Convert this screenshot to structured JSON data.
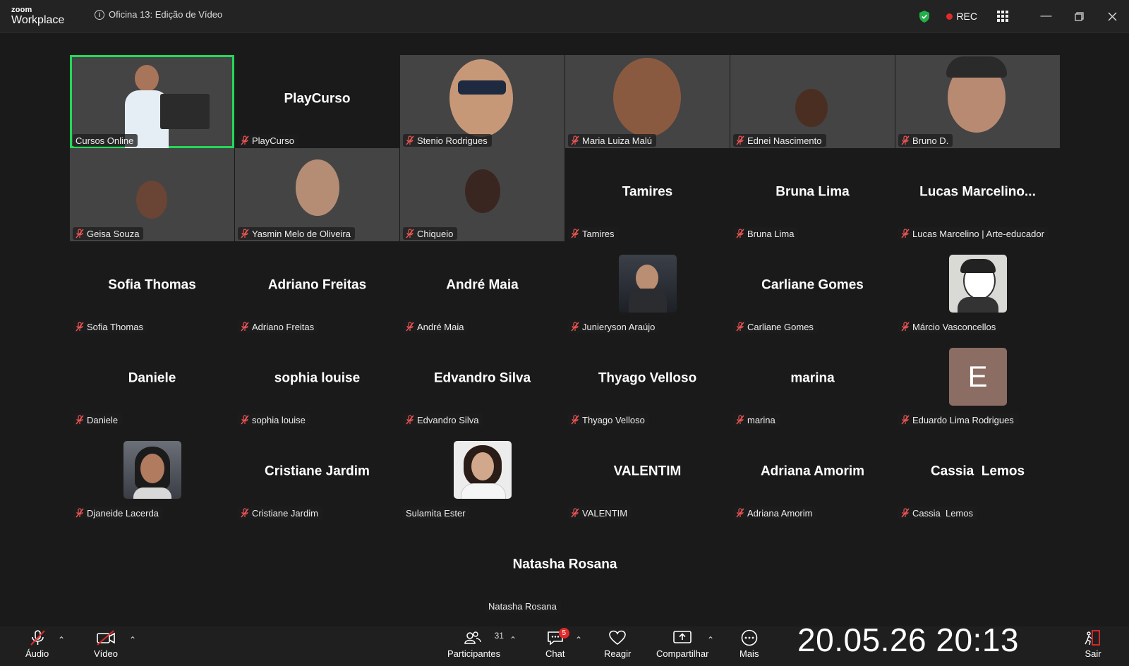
{
  "app": {
    "brand_small": "zoom",
    "brand_big": "Workplace",
    "meeting_title": "Oficina 13: Edição de Vídeo"
  },
  "status": {
    "rec_label": "REC",
    "colors": {
      "rec": "#e02b2b",
      "shield": "#23b04a",
      "active_speaker": "#23d959"
    }
  },
  "participants": [
    {
      "name": "Cursos Online",
      "kind": "video",
      "muted": false,
      "active": true
    },
    {
      "name": "PlayCurso",
      "kind": "name",
      "muted": true
    },
    {
      "name": "Stenio Rodrigues",
      "kind": "video",
      "muted": true
    },
    {
      "name": "Maria Luiza Malú",
      "kind": "video",
      "muted": true
    },
    {
      "name": "Ednei Nascimento",
      "kind": "video",
      "muted": true
    },
    {
      "name": "Bruno D.",
      "kind": "video",
      "muted": true
    },
    {
      "name": "Geisa Souza",
      "kind": "video",
      "muted": true
    },
    {
      "name": "Yasmin Melo de Oliveira",
      "kind": "video",
      "muted": true
    },
    {
      "name": "Chiqueio",
      "kind": "video",
      "muted": true
    },
    {
      "name": "Tamires",
      "kind": "name",
      "muted": true
    },
    {
      "name": "Bruna Lima",
      "kind": "name",
      "muted": true
    },
    {
      "name": "Lucas Marcelino | Arte-educador",
      "big_name": "Lucas  Marcelino...",
      "kind": "name",
      "muted": true
    },
    {
      "name": "Sofia Thomas",
      "kind": "name",
      "muted": true
    },
    {
      "name": "Adriano Freitas",
      "kind": "name",
      "muted": true
    },
    {
      "name": "André Maia",
      "kind": "name",
      "muted": true
    },
    {
      "name": "Junieryson Araújo",
      "kind": "photo",
      "muted": true
    },
    {
      "name": "Carliane Gomes",
      "kind": "name",
      "muted": true
    },
    {
      "name": "Márcio Vasconcellos",
      "kind": "photo",
      "muted": true
    },
    {
      "name": "Daniele",
      "kind": "name",
      "muted": true
    },
    {
      "name": "sophia louise",
      "kind": "name",
      "muted": true
    },
    {
      "name": "Edvandro Silva",
      "kind": "name",
      "muted": true
    },
    {
      "name": "Thyago Velloso",
      "kind": "name",
      "muted": true
    },
    {
      "name": "marina",
      "kind": "name",
      "muted": true
    },
    {
      "name": "Eduardo Lima Rodrigues",
      "kind": "letter",
      "letter": "E",
      "muted": true
    },
    {
      "name": "Djaneide Lacerda",
      "kind": "photo",
      "muted": true
    },
    {
      "name": "Cristiane Jardim",
      "kind": "name",
      "muted": true
    },
    {
      "name": "Sulamita Ester",
      "kind": "photo",
      "muted": false
    },
    {
      "name": "VALENTIM",
      "kind": "name",
      "muted": true
    },
    {
      "name": "Adriana Amorim",
      "kind": "name",
      "muted": true
    },
    {
      "name": "Cassia  Lemos",
      "kind": "name",
      "muted": true
    },
    {
      "name": "Natasha Rosana",
      "kind": "name",
      "muted": false
    }
  ],
  "toolbar": {
    "audio": "Áudio",
    "video": "Vídeo",
    "participants": "Participantes",
    "participants_count": "31",
    "chat": "Chat",
    "chat_badge": "5",
    "react": "Reagir",
    "share": "Compartilhar",
    "more": "Mais",
    "leave": "Sair"
  },
  "overlay_clock": "20.05.26 20:13"
}
